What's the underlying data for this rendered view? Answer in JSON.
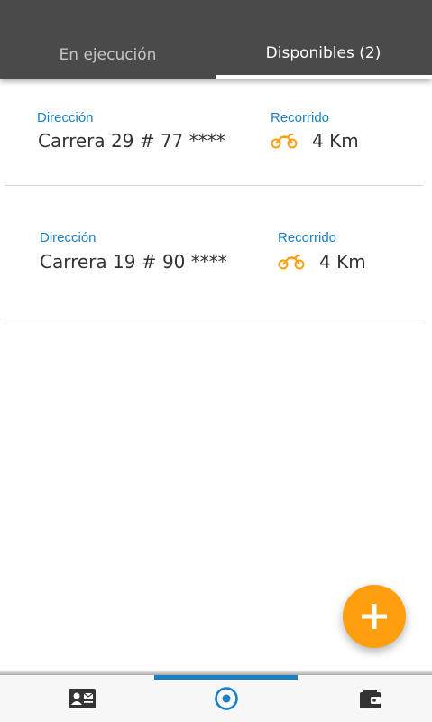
{
  "tabs": [
    {
      "label": "En ejecución",
      "active": false
    },
    {
      "label": "Disponibles (2)",
      "active": true
    }
  ],
  "services": [
    {
      "address_label": "Dirección",
      "address": "Carrera 29  # 77 ****",
      "distance_label": "Recorrido",
      "distance": "4 Km",
      "vehicle_icon": "motorcycle-icon"
    },
    {
      "address_label": "Dirección",
      "address": "Carrera 19  # 90 ****",
      "distance_label": "Recorrido",
      "distance": "4 Km",
      "vehicle_icon": "motorcycle-icon"
    }
  ],
  "fab": {
    "icon": "plus-icon"
  },
  "bottom_nav": [
    {
      "icon": "contact-card-icon",
      "active": false
    },
    {
      "icon": "target-icon",
      "active": true
    },
    {
      "icon": "wallet-icon",
      "active": false
    }
  ],
  "colors": {
    "header_bg": "#4a4a4a",
    "accent_blue": "#1a7fc4",
    "accent_orange": "#ff9f0f",
    "text_dark": "#333333"
  }
}
